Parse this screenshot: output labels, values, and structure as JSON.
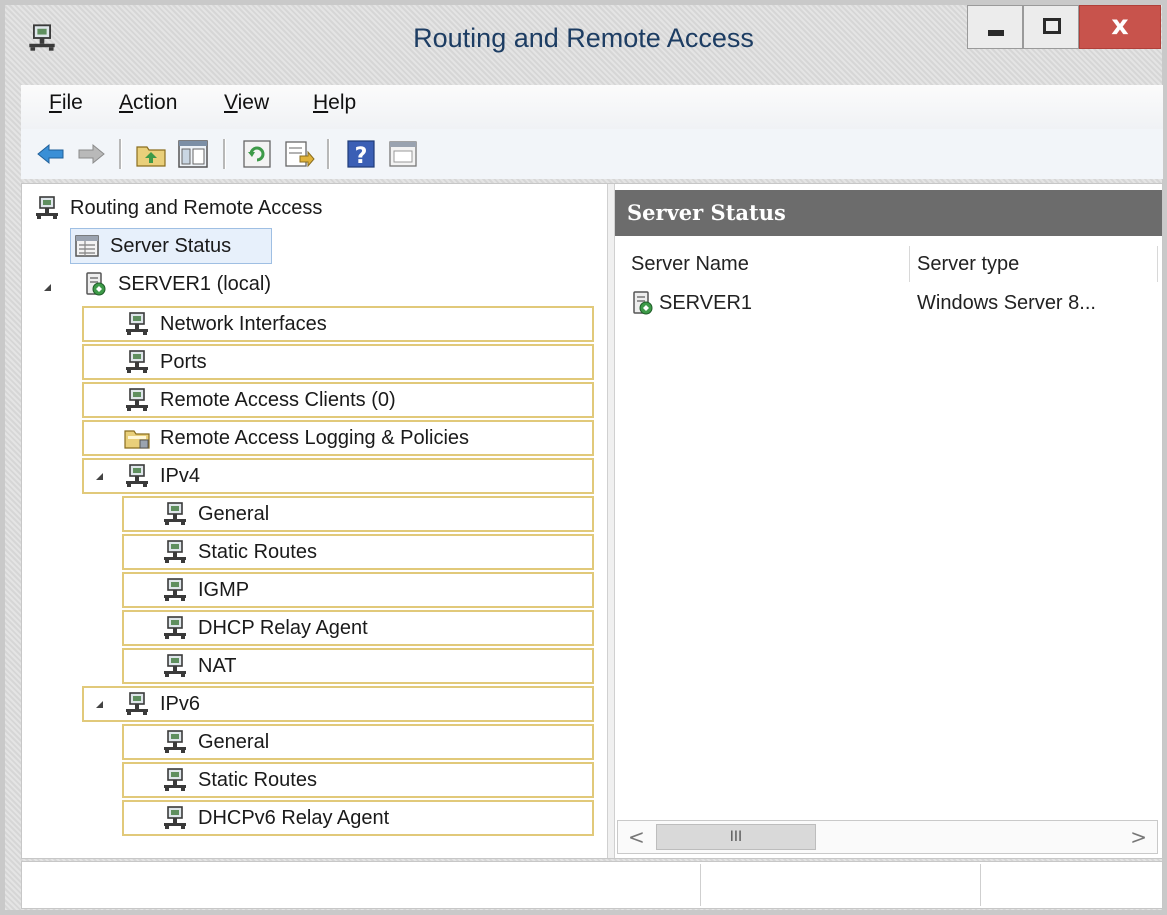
{
  "window": {
    "title": "Routing and Remote Access",
    "close_glyph": "x"
  },
  "menu": [
    {
      "pre": "",
      "mnemonic": "F",
      "rest": "ile"
    },
    {
      "pre": "",
      "mnemonic": "A",
      "rest": "ction"
    },
    {
      "pre": "",
      "mnemonic": "V",
      "rest": "iew"
    },
    {
      "pre": "",
      "mnemonic": "H",
      "rest": "elp"
    }
  ],
  "toolbar": {
    "icons": [
      "back-arrow-icon",
      "forward-arrow-icon",
      "up-folder-icon",
      "show-hide-tree-icon",
      "refresh-icon",
      "export-list-icon",
      "help-icon",
      "console-tree-icon"
    ]
  },
  "tree": {
    "root": "Routing and Remote Access",
    "server_status": "Server Status",
    "server": "SERVER1 (local)",
    "network_interfaces": "Network Interfaces",
    "ports": "Ports",
    "remote_access_clients": "Remote Access Clients (0)",
    "logging_policies": "Remote Access Logging & Policies",
    "ipv4": {
      "label": "IPv4",
      "children": [
        "General",
        "Static Routes",
        "IGMP",
        "DHCP Relay Agent",
        "NAT"
      ]
    },
    "ipv6": {
      "label": "IPv6",
      "children": [
        "General",
        "Static Routes",
        "DHCPv6 Relay Agent"
      ]
    }
  },
  "results": {
    "header": "Server Status",
    "columns": [
      "Server Name",
      "Server type"
    ],
    "rows": [
      {
        "name": "SERVER1",
        "type": "Windows Server 8..."
      }
    ]
  },
  "scrollbar": {
    "left": "<",
    "right": ">",
    "thumb": "III"
  },
  "colors": {
    "close_button": "#c8534c",
    "results_header": "#6c6c6c",
    "tree_highlight_border": "#e1c97a",
    "title_text": "#1d3d63"
  }
}
